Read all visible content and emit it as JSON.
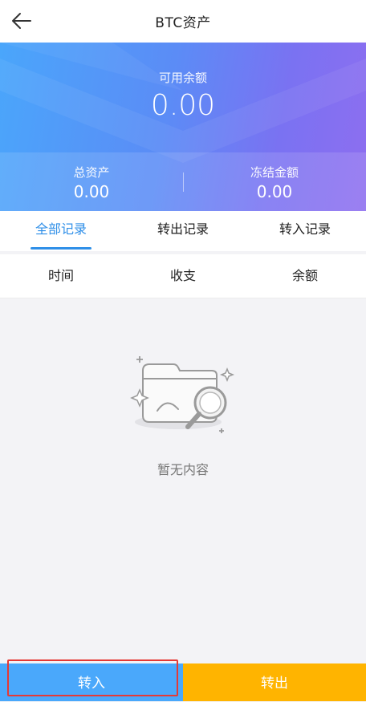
{
  "header": {
    "title": "BTC资产"
  },
  "balance": {
    "available_label": "可用余额",
    "available_value": "0.00",
    "total_label": "总资产",
    "total_value": "0.00",
    "frozen_label": "冻结金额",
    "frozen_value": "0.00"
  },
  "tabs": [
    {
      "label": "全部记录",
      "active": true
    },
    {
      "label": "转出记录",
      "active": false
    },
    {
      "label": "转入记录",
      "active": false
    }
  ],
  "columns": [
    "时间",
    "收支",
    "余额"
  ],
  "empty": {
    "text": "暂无内容",
    "icon": "empty-folder-magnifier-icon"
  },
  "actions": {
    "transfer_in": "转入",
    "transfer_out": "转出"
  },
  "colors": {
    "accent": "#2f8fe8",
    "transfer_in": "#4aa8fb",
    "transfer_out": "#ffb400"
  }
}
